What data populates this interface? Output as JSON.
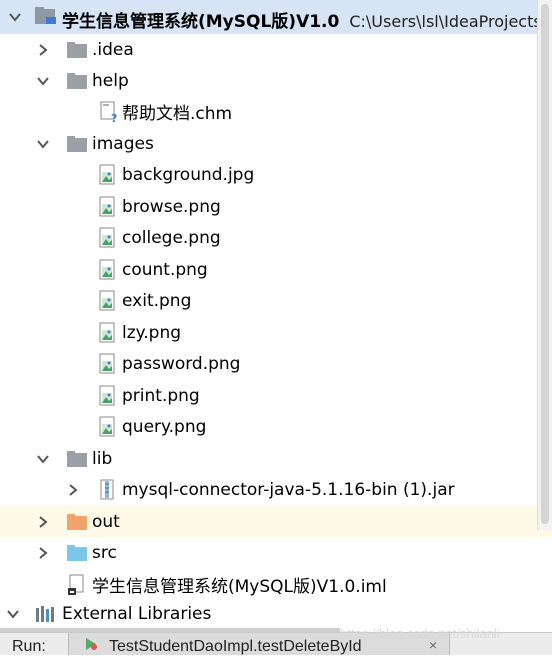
{
  "project": {
    "name": "学生信息管理系统(MySQL版)V1.0",
    "path": "C:\\Users\\lsl\\IdeaProjects"
  },
  "tree": {
    "idea": ".idea",
    "help": "help",
    "help_file": "帮助文档.chm",
    "images": "images",
    "image_files": [
      "background.jpg",
      "browse.png",
      "college.png",
      "count.png",
      "exit.png",
      "lzy.png",
      "password.png",
      "print.png",
      "query.png"
    ],
    "lib": "lib",
    "lib_jar": "mysql-connector-java-5.1.16-bin (1).jar",
    "out": "out",
    "src": "src",
    "iml": "学生信息管理系统(MySQL版)V1.0.iml",
    "external_libraries": "External Libraries"
  },
  "run": {
    "label": "Run:",
    "tab": "TestStudentDaoImpl.testDeleteById",
    "close": "×"
  },
  "watermark": "https://blog.csdn.net/shilanli",
  "colors": {
    "folder": "#9aa0a6",
    "out_folder": "#f0a46b",
    "src_folder": "#7cc7e8",
    "root_highlight": "#d6e4f5",
    "out_highlight": "#fdfbe8"
  }
}
